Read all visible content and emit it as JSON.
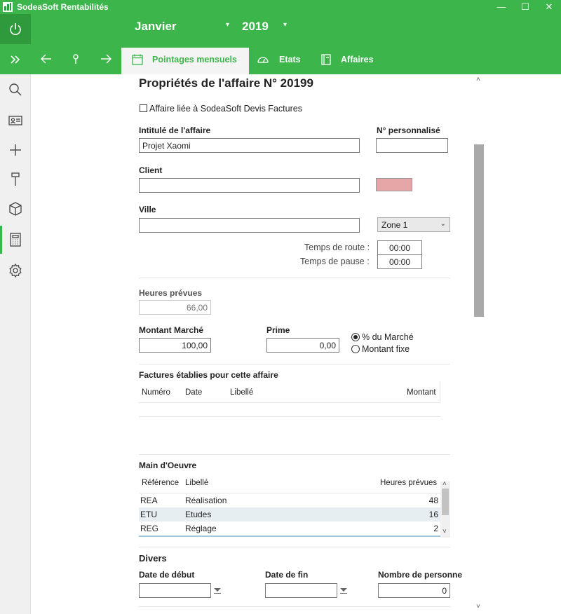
{
  "window": {
    "title": "SodeaSoft Rentabilités",
    "minimize": "—",
    "maximize": "☐",
    "close": "✕"
  },
  "header": {
    "month": "Janvier",
    "year": "2019",
    "tabs": [
      {
        "label": "Pointages mensuels",
        "active": true
      },
      {
        "label": "Etats",
        "active": false
      },
      {
        "label": "Affaires",
        "active": false
      }
    ]
  },
  "colors": {
    "brand_green": "#3cb54a",
    "brand_green_dark": "#2e9a3c",
    "pink_swatch": "#e6a6a8"
  },
  "icons": {
    "rail": [
      "power-icon",
      "expand-icon",
      "search-icon",
      "contact-card-icon",
      "plus-icon",
      "hammer-icon",
      "box-icon",
      "calculator-icon",
      "gear-icon"
    ],
    "nav": [
      "back-arrow-icon",
      "pin-icon",
      "forward-arrow-icon"
    ]
  },
  "form": {
    "title": "Propriétés de l'affaire N° 20199",
    "linked_checkbox_label": "Affaire liée à SodeaSoft Devis Factures",
    "intitule_label": "Intitulé de l'affaire",
    "intitule_value": "Projet Xaomi",
    "perso_label": "N° personnalisé",
    "perso_value": "",
    "client_label": "Client",
    "client_value": "",
    "ville_label": "Ville",
    "ville_value": "",
    "zone_value": "Zone 1",
    "temps_route_label": "Temps de route :",
    "temps_route_value": "00:00",
    "temps_pause_label": "Temps de pause :",
    "temps_pause_value": "00:00",
    "heures_prevues_label": "Heures prévues",
    "heures_prevues_value": "66,00",
    "montant_label": "Montant Marché",
    "montant_value": "100,00",
    "prime_label": "Prime",
    "prime_value": "0,00",
    "radio_pct_label": "% du Marché",
    "radio_fixe_label": "Montant fixe",
    "factures_title": "Factures établies pour cette affaire",
    "factures_columns": {
      "numero": "Numéro",
      "date": "Date",
      "libelle": "Libellé",
      "montant": "Montant"
    },
    "mo_title": "Main d'Oeuvre",
    "mo_columns": {
      "reference": "Référence",
      "libelle": "Libellé",
      "heures": "Heures prévues"
    },
    "mo_rows": [
      {
        "ref": "REA",
        "libelle": "Réalisation",
        "heures": "48"
      },
      {
        "ref": "ETU",
        "libelle": "Etudes",
        "heures": "16"
      },
      {
        "ref": "REG",
        "libelle": "Réglage",
        "heures": "2"
      }
    ],
    "divers_title": "Divers",
    "date_debut_label": "Date de début",
    "date_debut_value": "",
    "date_fin_label": "Date de fin",
    "date_fin_value": "",
    "nb_personne_label": "Nombre de personne",
    "nb_personne_value": "0"
  }
}
